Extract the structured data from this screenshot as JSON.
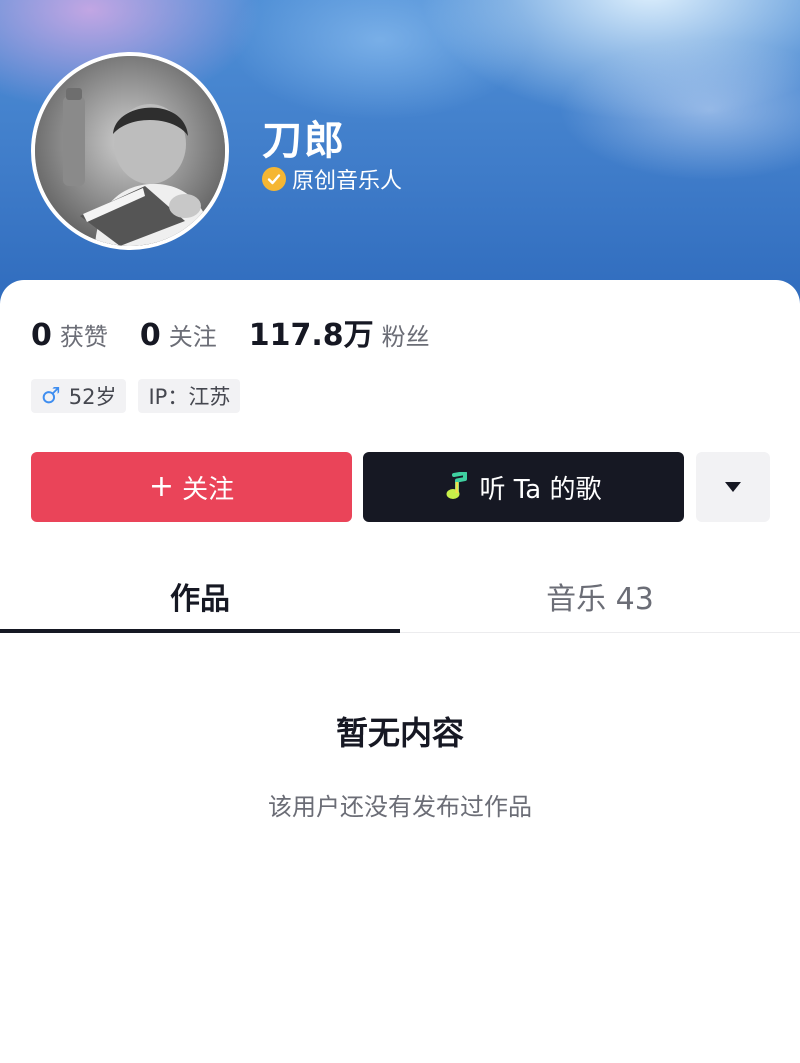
{
  "profile": {
    "name": "刀郎",
    "verification": "原创音乐人",
    "avatar_icon": "avatar-photo"
  },
  "stats": [
    {
      "value": "0",
      "label": "获赞"
    },
    {
      "value": "0",
      "label": "关注"
    },
    {
      "value": "117.8万",
      "label": "粉丝"
    }
  ],
  "tags": {
    "age": "52岁",
    "ip": "IP：江苏"
  },
  "actions": {
    "follow_label": "关注",
    "listen_label": "听 Ta 的歌",
    "more_icon": "triangle-down-icon"
  },
  "tabs": {
    "works": "作品",
    "music": "音乐 43"
  },
  "empty_state": {
    "title": "暂无内容",
    "subtitle": "该用户还没有发布过作品"
  },
  "colors": {
    "follow": "#ea4459",
    "listen": "#161823",
    "verify_badge": "#f5b633",
    "banner": "#3f7cc9"
  }
}
